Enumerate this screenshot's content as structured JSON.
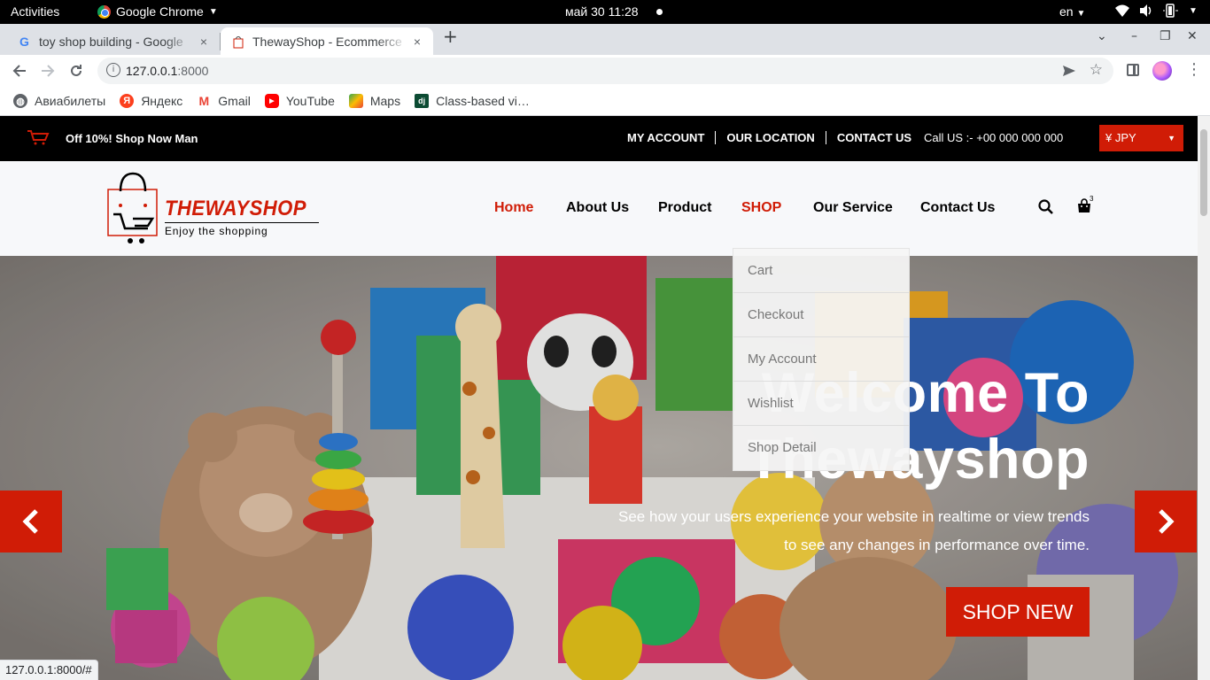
{
  "system": {
    "activities": "Activities",
    "app_name": "Google Chrome",
    "clock": "май 30  11:28",
    "lang": "en"
  },
  "browser": {
    "tabs": [
      {
        "title": "toy shop building - Google",
        "close": "×"
      },
      {
        "title": "ThewayShop - Ecommerce",
        "close": "×"
      }
    ],
    "new_tab": "+",
    "url_host": "127.0.0.1",
    "url_port": ":8000",
    "bookmarks": [
      {
        "label": "Авиабилеты",
        "icon": "globe-icon"
      },
      {
        "label": "Яндекс",
        "icon": "yandex-icon"
      },
      {
        "label": "Gmail",
        "icon": "gmail-icon"
      },
      {
        "label": "YouTube",
        "icon": "youtube-icon"
      },
      {
        "label": "Maps",
        "icon": "maps-icon"
      },
      {
        "label": "Class-based vi…",
        "icon": "django-icon"
      }
    ],
    "status_url": "127.0.0.1:8000/#"
  },
  "site": {
    "topbar": {
      "promo": "Off 10%! Shop Now Man",
      "links": [
        "MY ACCOUNT",
        "OUR LOCATION",
        "CONTACT US"
      ],
      "call": "Call US :- +00 000 000 000",
      "currency": "¥ JPY"
    },
    "logo": {
      "brand": "THEWAYSHOP",
      "tagline": "Enjoy the shopping"
    },
    "nav": [
      {
        "label": "Home",
        "active": true
      },
      {
        "label": "About Us",
        "active": false
      },
      {
        "label": "Product",
        "active": false
      },
      {
        "label": "SHOP",
        "active": true
      },
      {
        "label": "Our Service",
        "active": false
      },
      {
        "label": "Contact Us",
        "active": false
      }
    ],
    "cart_count": "3",
    "shop_dropdown": [
      "Cart",
      "Checkout",
      "My Account",
      "Wishlist",
      "Shop Detail"
    ],
    "hero": {
      "title_line1": "Welcome To",
      "title_line2": "Thewayshop",
      "text": "See how your users experience your website in realtime or view trends to see any changes in performance over time.",
      "button": "SHOP NEW"
    },
    "colors": {
      "accent": "#d01c06",
      "topbar_bg": "#000000",
      "header_bg": "#f7f8fa"
    }
  }
}
